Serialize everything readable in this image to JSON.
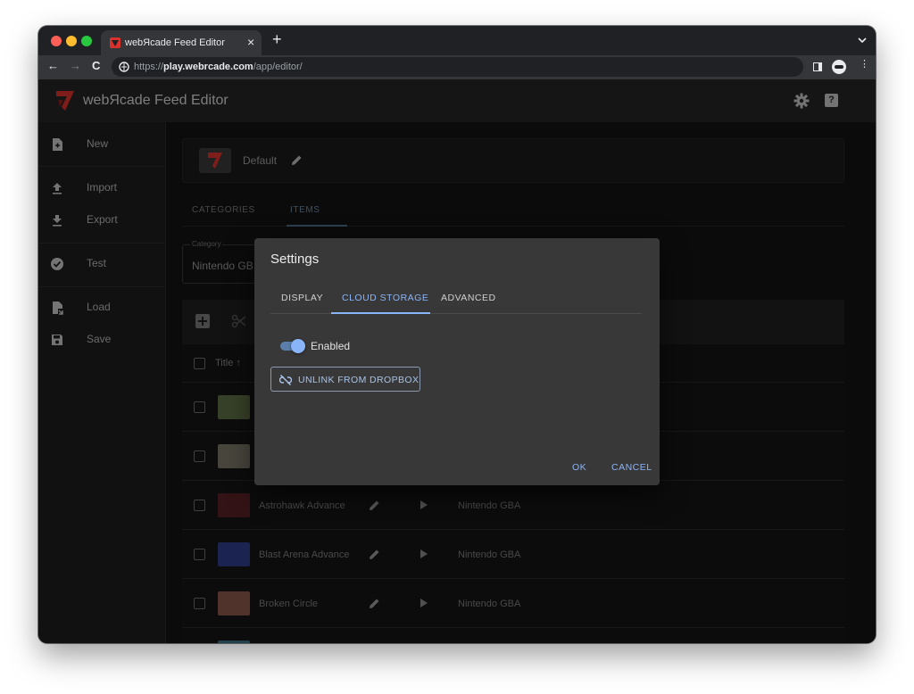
{
  "browser": {
    "tab_title": "webЯcade Feed Editor",
    "tab_close": "×",
    "new_tab": "+",
    "url_protocol": "https://",
    "url_host": "play.webrcade.com",
    "url_path": "/app/editor/",
    "back": "←",
    "forward": "→",
    "reload": "C",
    "menu": "⋮"
  },
  "header": {
    "title": "webЯcade Feed Editor",
    "help": "?"
  },
  "sidebar": {
    "items": [
      {
        "label": "New",
        "icon": "new-file-icon"
      },
      {
        "label": "Import",
        "icon": "upload-icon"
      },
      {
        "label": "Export",
        "icon": "download-icon"
      },
      {
        "label": "Test",
        "icon": "check-circle-icon"
      },
      {
        "label": "Load",
        "icon": "load-file-icon"
      },
      {
        "label": "Save",
        "icon": "save-icon"
      }
    ]
  },
  "feed": {
    "name": "Default"
  },
  "editor_tabs": [
    {
      "label": "CATEGORIES",
      "active": false
    },
    {
      "label": "ITEMS",
      "active": true
    }
  ],
  "category_select": {
    "legend": "Category",
    "value": "Nintendo GB"
  },
  "grid": {
    "title_header": "Title ↑",
    "rows": [
      {
        "name": "",
        "type": "",
        "thumb_color": "#5f6f45"
      },
      {
        "name": "",
        "type": "",
        "thumb_color": "#7a7868"
      },
      {
        "name": "Astrohawk Advance",
        "type": "Nintendo GBA",
        "thumb_color": "#5a2226"
      },
      {
        "name": "Blast Arena Advance",
        "type": "Nintendo GBA",
        "thumb_color": "#2f3f8c"
      },
      {
        "name": "Broken Circle",
        "type": "Nintendo GBA",
        "thumb_color": "#8a5a4a"
      }
    ]
  },
  "dialog": {
    "title": "Settings",
    "tabs": [
      {
        "label": "DISPLAY",
        "active": false
      },
      {
        "label": "CLOUD STORAGE",
        "active": true
      },
      {
        "label": "ADVANCED",
        "active": false
      }
    ],
    "enabled_label": "Enabled",
    "enabled_on": true,
    "unlink_label": "UNLINK FROM DROPBOX",
    "ok_label": "OK",
    "cancel_label": "CANCEL"
  },
  "colors": {
    "accent": "#8ab4f8",
    "brand_red": "#d9322c",
    "app_bg": "#1e1e1e"
  }
}
